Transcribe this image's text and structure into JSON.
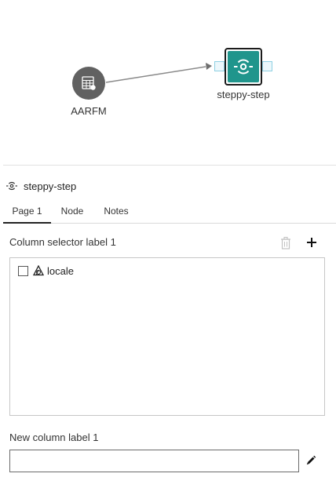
{
  "canvas": {
    "source_node": {
      "label": "AARFM",
      "icon": "table-database-icon"
    },
    "step_node": {
      "label": "steppy-step",
      "icon": "steppy-step-icon",
      "accent": "#20958c"
    }
  },
  "panel": {
    "title": "steppy-step",
    "title_icon": "steppy-step-icon",
    "tabs": [
      {
        "label": "Page 1",
        "active": true
      },
      {
        "label": "Node",
        "active": false
      },
      {
        "label": "Notes",
        "active": false
      }
    ],
    "column_selector": {
      "label": "Column selector label 1",
      "columns": [
        {
          "name": "locale",
          "icon": "categorical-column-icon",
          "checked": false
        }
      ]
    },
    "new_column": {
      "label": "New column label 1",
      "value": ""
    }
  }
}
